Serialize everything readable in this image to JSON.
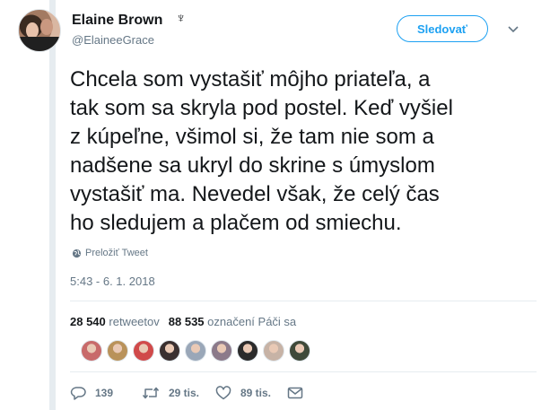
{
  "author": {
    "display_name": "Elaine Brown",
    "badge_glyph": "♆",
    "handle": "@ElaineeGrace",
    "avatar_icon": "profile-photo"
  },
  "follow_button": {
    "label": "Sledovať"
  },
  "menu": {
    "icon": "chevron-down-icon"
  },
  "tweet": {
    "text": "Chcela som vystašiť môjho priateľa, a\ntak som sa skryla pod postel. Keď vyšiel\nz kúpeľne, všimol si, že tam nie som a\nnadšene sa ukryl do skrine s úmyslom\nvystašiť ma. Nevedel však, že celý čas\nho sledujem a plačem od smiechu.",
    "translate_label": "Preložiť Tweet",
    "timestamp": "5:43 - 6. 1. 2018"
  },
  "stats": {
    "retweets_count": "28 540",
    "retweets_label": "retweetov",
    "likes_count": "88 535",
    "likes_label": "označení Páči sa"
  },
  "likers": [
    {
      "name": "liker-avatar",
      "color": "#c86a6a"
    },
    {
      "name": "liker-avatar",
      "color": "#b9925a"
    },
    {
      "name": "liker-avatar",
      "color": "#d04a4a"
    },
    {
      "name": "liker-avatar",
      "color": "#3a3030"
    },
    {
      "name": "liker-avatar",
      "color": "#9aa7b8"
    },
    {
      "name": "liker-avatar",
      "color": "#8c7a8a"
    },
    {
      "name": "liker-avatar",
      "color": "#2b2b2b"
    },
    {
      "name": "liker-avatar",
      "color": "#c7b3a6"
    },
    {
      "name": "liker-avatar",
      "color": "#3f4a3a"
    }
  ],
  "actions": {
    "reply_count": "139",
    "retweet_count": "29 tis.",
    "like_count": "89 tis."
  },
  "colors": {
    "accent": "#1da1f2",
    "secondary_text": "#657786",
    "rail": "#e6ecf0"
  }
}
